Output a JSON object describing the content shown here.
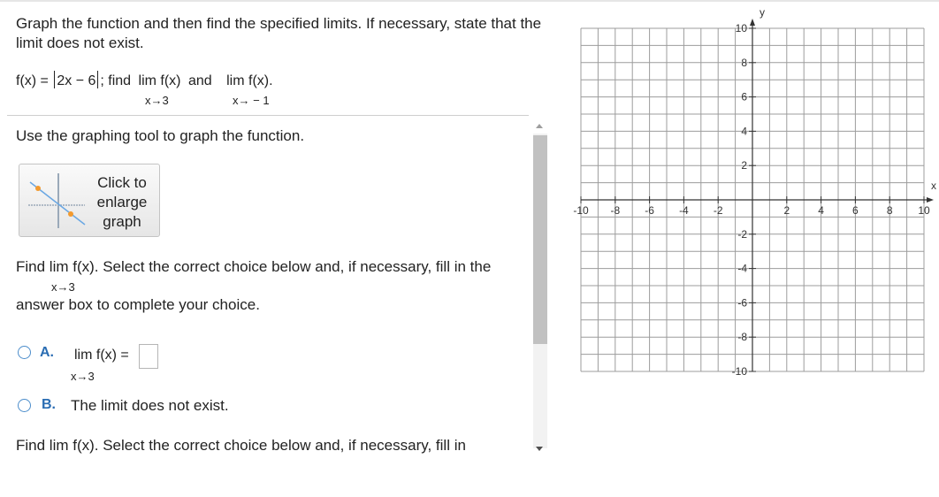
{
  "intro": "Graph the function and then find the specified limits. If necessary, state that the limit does not exist.",
  "function_line": {
    "f_prefix": "f(x) =",
    "abs_inner": "2x − 6",
    "find": "; find",
    "lim1": "lim f(x)",
    "and": "and",
    "lim2": "lim f(x).",
    "sub1": "x→3",
    "sub2": "x→ − 1"
  },
  "instruction": "Use the graphing tool to graph the function.",
  "enlarge_button": {
    "line1": "Click to",
    "line2": "enlarge",
    "line3": "graph"
  },
  "find1": {
    "text": "Find  lim f(x). Select the correct choice below and, if necessary, fill in the",
    "sub": "x→3",
    "text2": "answer box to complete your choice."
  },
  "choice_a": {
    "letter": "A.",
    "lim": "lim f(x) =",
    "sub": "x→3",
    "value": ""
  },
  "choice_b": {
    "letter": "B.",
    "text": "The limit does not exist."
  },
  "find2": {
    "text": "Find   lim   f(x). Select the correct choice below and, if necessary, fill in"
  },
  "graph": {
    "x_label": "x",
    "y_label": "y",
    "x_ticks": [
      "-10",
      "-8",
      "-6",
      "-4",
      "-2",
      "2",
      "4",
      "6",
      "8",
      "10"
    ],
    "y_ticks": [
      "10",
      "8",
      "6",
      "4",
      "2",
      "-2",
      "-4",
      "-6",
      "-8",
      "-10"
    ],
    "range": [
      -10,
      10
    ],
    "grid_color": "#9c9c9c"
  }
}
